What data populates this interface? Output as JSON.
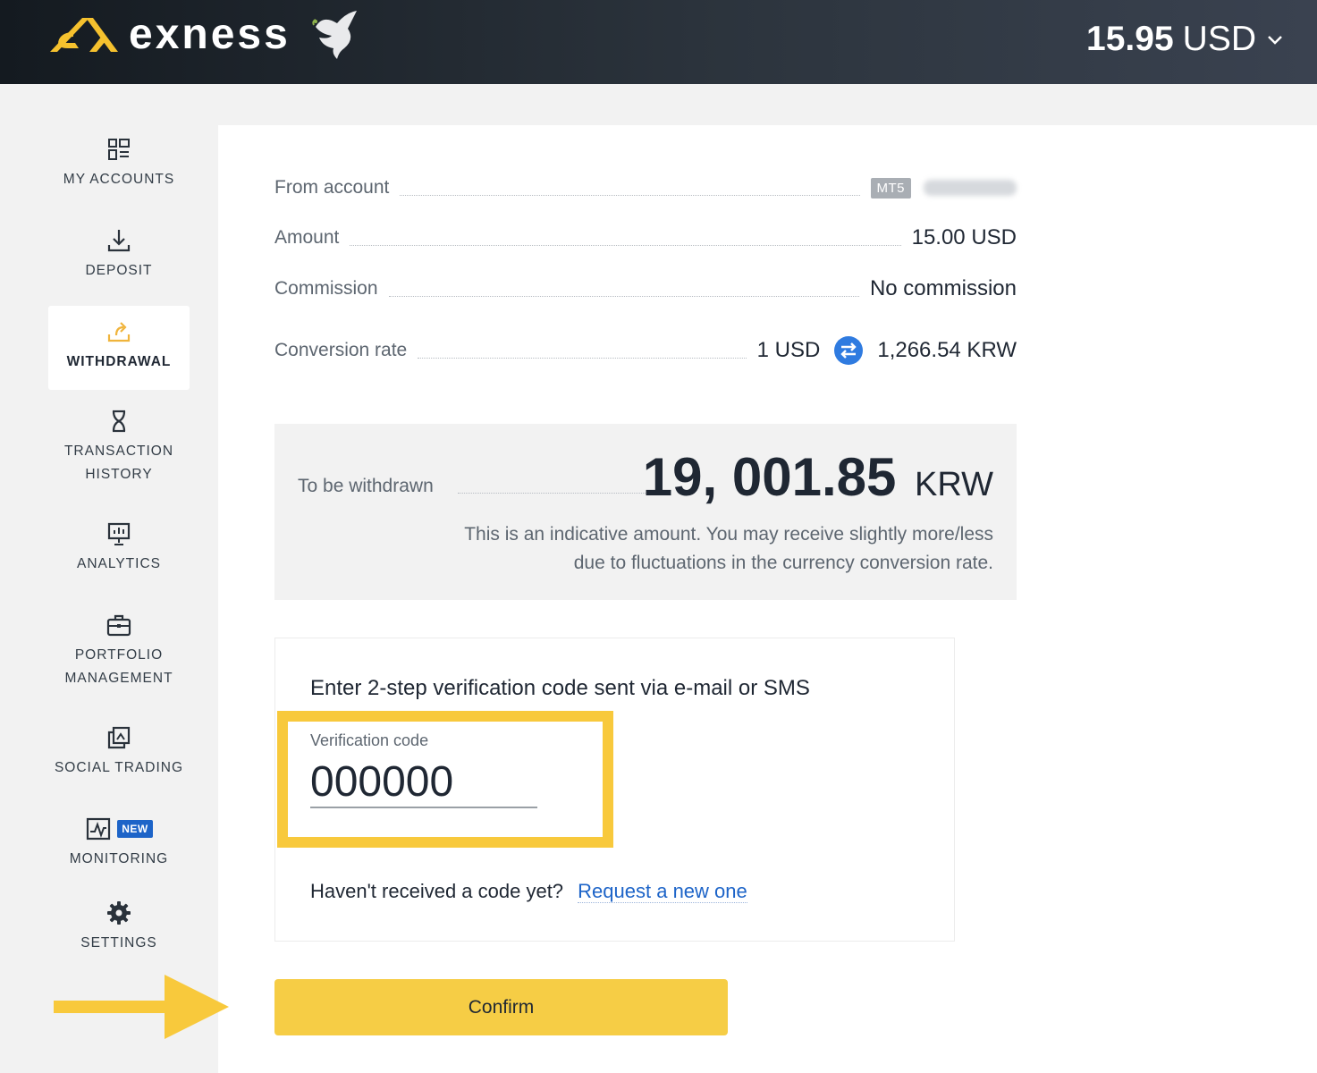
{
  "header": {
    "brand": "exness",
    "balance_amount": "15.95",
    "balance_currency": "USD"
  },
  "sidebar": {
    "items": [
      {
        "label": "MY ACCOUNTS",
        "icon": "grid-icon"
      },
      {
        "label": "DEPOSIT",
        "icon": "download-icon"
      },
      {
        "label": "WITHDRAWAL",
        "icon": "upload-icon",
        "active": true
      },
      {
        "label": "TRANSACTION",
        "label2": "HISTORY",
        "icon": "hourglass-icon"
      },
      {
        "label": "ANALYTICS",
        "icon": "presentation-chart-icon"
      },
      {
        "label": "PORTFOLIO",
        "label2": "MANAGEMENT",
        "icon": "briefcase-icon"
      },
      {
        "label": "SOCIAL TRADING",
        "icon": "copy-trading-icon"
      },
      {
        "label": "MONITORING",
        "icon": "monitoring-chart-icon",
        "badge": "NEW"
      },
      {
        "label": "SETTINGS",
        "icon": "gear-icon"
      }
    ]
  },
  "summary": {
    "from_account_label": "From account",
    "from_account_type": "MT5",
    "amount_label": "Amount",
    "amount_value": "15.00 USD",
    "commission_label": "Commission",
    "commission_value": "No commission",
    "conversion_label": "Conversion rate",
    "conversion_from": "1 USD",
    "conversion_to": "1,266.54 KRW"
  },
  "withdrawal": {
    "label": "To be withdrawn",
    "amount": "19, 001.85",
    "currency": "KRW",
    "note_line1": "This is an indicative amount. You may receive slightly more/less",
    "note_line2": "due to fluctuations in the currency conversion rate."
  },
  "verification": {
    "title": "Enter 2-step verification code sent via e-mail or SMS",
    "field_label": "Verification code",
    "field_value": "000000",
    "resend_text": "Haven't received a code yet?",
    "resend_link": "Request a new one"
  },
  "actions": {
    "confirm_label": "Confirm"
  },
  "colors": {
    "accent_yellow": "#f8c93c",
    "button_yellow": "#f6cd45",
    "link_blue": "#1d64c8",
    "header_dark": "#141a20"
  }
}
